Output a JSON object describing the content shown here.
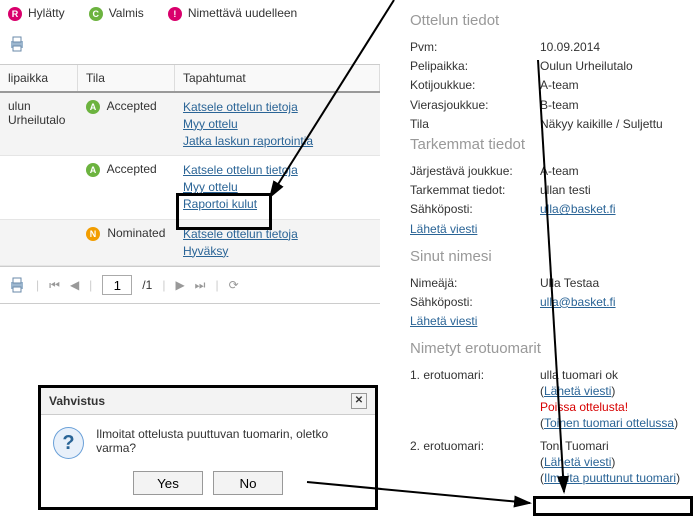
{
  "legend": {
    "r": "Hylätty",
    "c": "Valmis",
    "e": "Nimettävä uudelleen"
  },
  "grid": {
    "headers": {
      "col1": "lipaikka",
      "col2": "Tila",
      "col3": "Tapahtumat"
    },
    "rows": [
      {
        "place": "ulun Urheilutalo",
        "status_code": "A",
        "status": "Accepted",
        "actions": [
          "Katsele ottelun tietoja",
          "Myy ottelu",
          "Jatka laskun raportointia"
        ]
      },
      {
        "place": "",
        "status_code": "A",
        "status": "Accepted",
        "actions": [
          "Katsele ottelun tietoja",
          "Myy ottelu",
          "Raportoi kulut"
        ]
      },
      {
        "place": "",
        "status_code": "N",
        "status": "Nominated",
        "actions": [
          "Katsele ottelun tietoja",
          "Hyväksy"
        ]
      }
    ]
  },
  "pager": {
    "page": "1",
    "total": "/1"
  },
  "dialog": {
    "title": "Vahvistus",
    "message": "Ilmoitat ottelusta puuttuvan tuomarin, oletko varma?",
    "yes": "Yes",
    "no": "No"
  },
  "details": {
    "heading": "Ottelun tiedot",
    "pvm_k": "Pvm:",
    "pvm_v": "10.09.2014",
    "pelip_k": "Pelipaikka:",
    "pelip_v": "Oulun Urheilutalo",
    "koti_k": "Kotijoukkue:",
    "koti_v": "A-team",
    "vieras_k": "Vierasjoukkue:",
    "vieras_v": "B-team",
    "tila_k": "Tila",
    "tila_v": "Näkyy kaikille / Suljettu"
  },
  "tark": {
    "heading": "Tarkemmat tiedot",
    "jarj_k": "Järjestävä joukkue:",
    "jarj_v": "A-team",
    "tark_k": "Tarkemmat tiedot:",
    "tark_v": "ullan testi",
    "email_k": "Sähköposti:",
    "email_v": "ulla@basket.fi",
    "send": "Lähetä viesti"
  },
  "nimesi": {
    "heading": "Sinut nimesi",
    "nim_k": "Nimeäjä:",
    "nim_v": "Ulla Testaa",
    "email_k": "Sähköposti:",
    "email_v": "ulla@basket.fi",
    "send": "Lähetä viesti"
  },
  "eroto": {
    "heading": "Nimetyt erotuomarit",
    "r1_k": "1. erotuomari:",
    "r1_name": "ulla tuomari ok",
    "r1_send_open": "(",
    "r1_send": "Lähetä viesti",
    "r1_send_close": ")",
    "r1_away": "Poissa ottelusta!",
    "r1_other_open": "(",
    "r1_other": "Toinen tuomari ottelussa",
    "r1_other_close": ")",
    "r2_k": "2. erotuomari:",
    "r2_name": "Toni Tuomari",
    "r2_send_open": "(",
    "r2_send": "Lähetä viesti",
    "r2_send_close": ")",
    "r2_miss_open": "(",
    "r2_miss": "Ilmoita puuttunut tuomari",
    "r2_miss_close": ")"
  }
}
